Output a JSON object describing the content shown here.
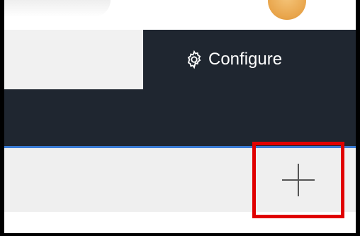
{
  "header": {
    "configure_label": "Configure",
    "configure_icon": "gear-icon"
  },
  "toolbar": {
    "add_icon": "plus-icon",
    "highlight_color": "#e00000"
  },
  "colors": {
    "dark_bar": "#1f2630",
    "accent_line": "#3a7bd5",
    "light_panel": "#efefef"
  }
}
